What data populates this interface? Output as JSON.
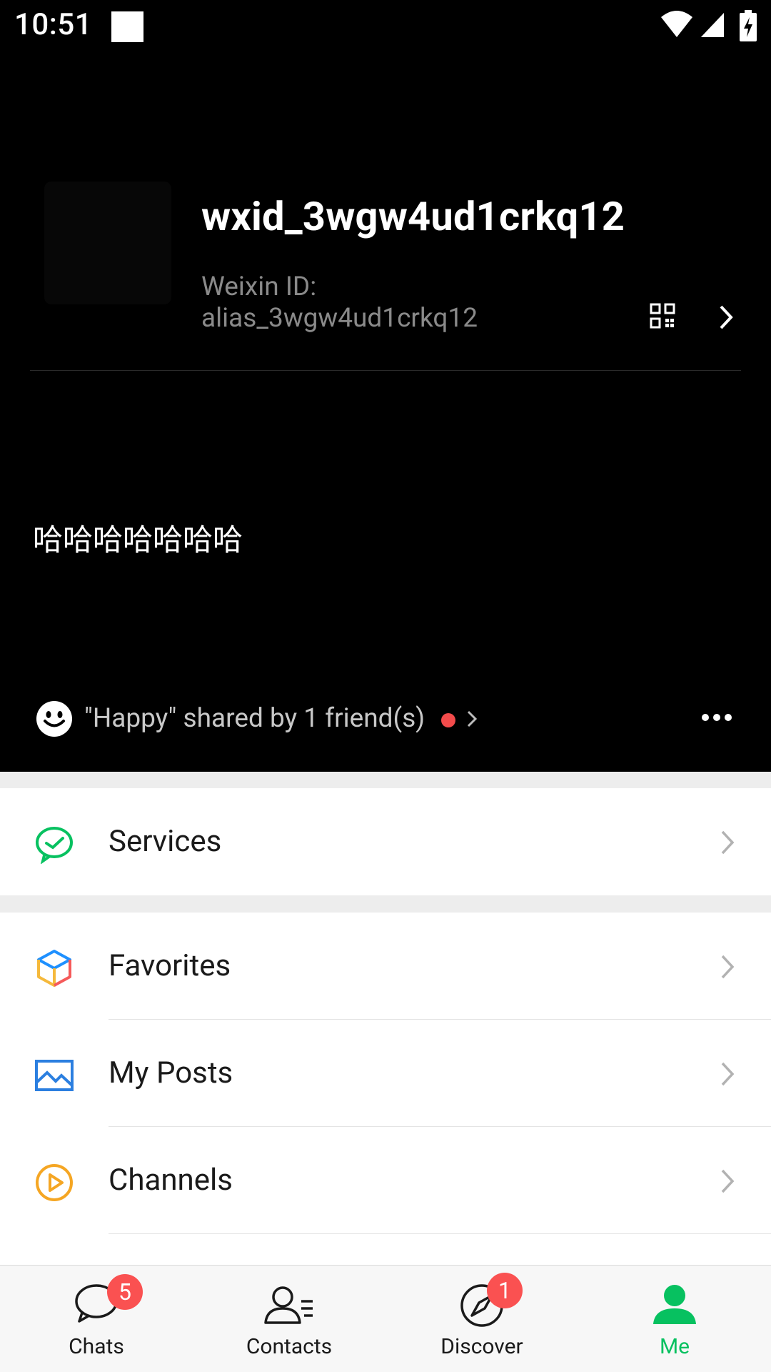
{
  "status_bar": {
    "time": "10:51",
    "icons": [
      "notification-square-icon",
      "wifi-icon",
      "cellular-signal-icon",
      "battery-charging-icon"
    ]
  },
  "profile": {
    "nickname": "wxid_3wgw4ud1crkq12",
    "wxid_label": "Weixin ID:",
    "wxid_value": "alias_3wgw4ud1crkq12",
    "signature": "哈哈哈哈哈哈哈",
    "status_text": "\"Happy\" shared by 1 friend(s)"
  },
  "menu": {
    "services": "Services",
    "favorites": "Favorites",
    "my_posts": "My Posts",
    "channels": "Channels"
  },
  "tabs": [
    {
      "label": "Chats",
      "badge": "5"
    },
    {
      "label": "Contacts",
      "badge": ""
    },
    {
      "label": "Discover",
      "badge": "1"
    },
    {
      "label": "Me",
      "badge": ""
    }
  ],
  "colors": {
    "accent_green": "#07c160",
    "badge_red": "#fa5151",
    "header_bg": "#000000",
    "divider_bg": "#ededed"
  }
}
